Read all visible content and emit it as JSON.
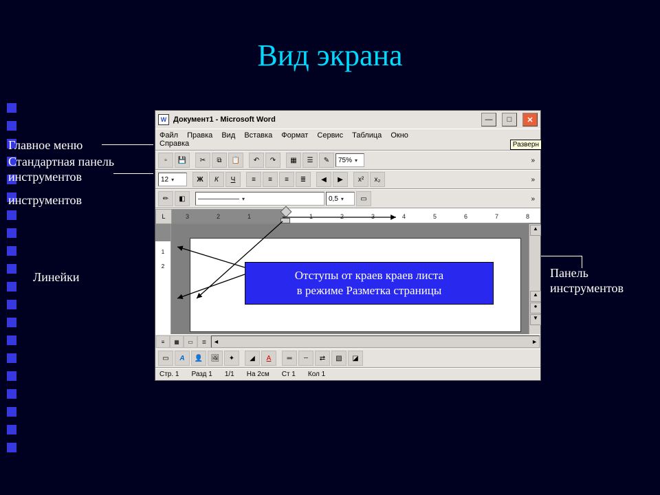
{
  "title": "Вид экрана",
  "labels": {
    "main_menu": "Главное меню",
    "std_toolbar": "Стандартная панель",
    "tools_word": "инструментов",
    "rulers": "Линейки",
    "right_panel1": "Панель",
    "right_panel2": "инструментов"
  },
  "window": {
    "doc_title": "Документ1 - Microsoft Word",
    "tooltip": "Разверн",
    "menu": [
      "Файл",
      "Правка",
      "Вид",
      "Вставка",
      "Формат",
      "Сервис",
      "Таблица",
      "Окно",
      "Справка"
    ],
    "zoom": "75%",
    "font_size": "12",
    "line_weight": "0,5",
    "format_bold": "Ж",
    "format_italic": "К",
    "format_underline": "Ч",
    "ruler_ticks": [
      "3",
      "2",
      "1",
      "1",
      "2",
      "3",
      "4",
      "5",
      "6",
      "7",
      "8"
    ],
    "vruler_ticks": [
      "1",
      "2"
    ],
    "corner": "L",
    "status": {
      "page": "Стр. 1",
      "section": "Разд 1",
      "pages": "1/1",
      "pos": "На  2см",
      "line": "Ст 1",
      "col": "Кол 1"
    }
  },
  "callout": {
    "line1": "Отступы от краев краев листа",
    "line2": "в режиме Разметка страницы"
  }
}
